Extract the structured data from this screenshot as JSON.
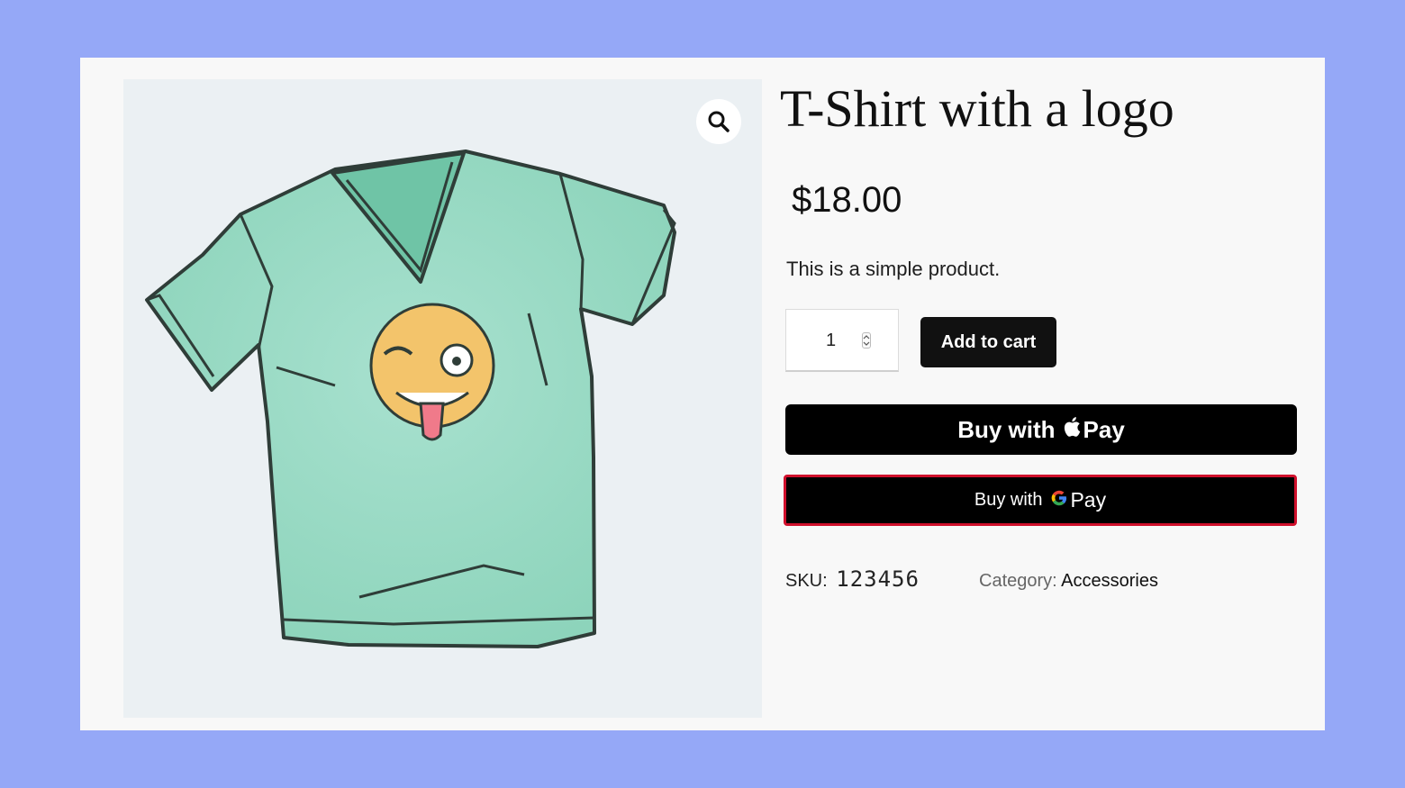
{
  "product": {
    "title": "T-Shirt with a logo",
    "price": "$18.00",
    "description": "This is a simple product.",
    "quantity": "1",
    "add_to_cart_label": "Add to cart",
    "apple_pay": {
      "prefix": "Buy with",
      "suffix": "Pay",
      "icon": "apple-icon"
    },
    "google_pay": {
      "prefix": "Buy with",
      "suffix": "Pay",
      "icon": "google-g-icon"
    },
    "sku_label": "SKU:",
    "sku_value": "123456",
    "category_label": "Category:",
    "category_value": "Accessories",
    "image_icon": "zoom-icon"
  },
  "colors": {
    "page_background": "#95a8f7",
    "card_background": "#f8f8f8",
    "image_background": "#ebf0f3",
    "shirt": "#9fdcc7",
    "highlight_border": "#d0102c",
    "button": "#111111"
  }
}
